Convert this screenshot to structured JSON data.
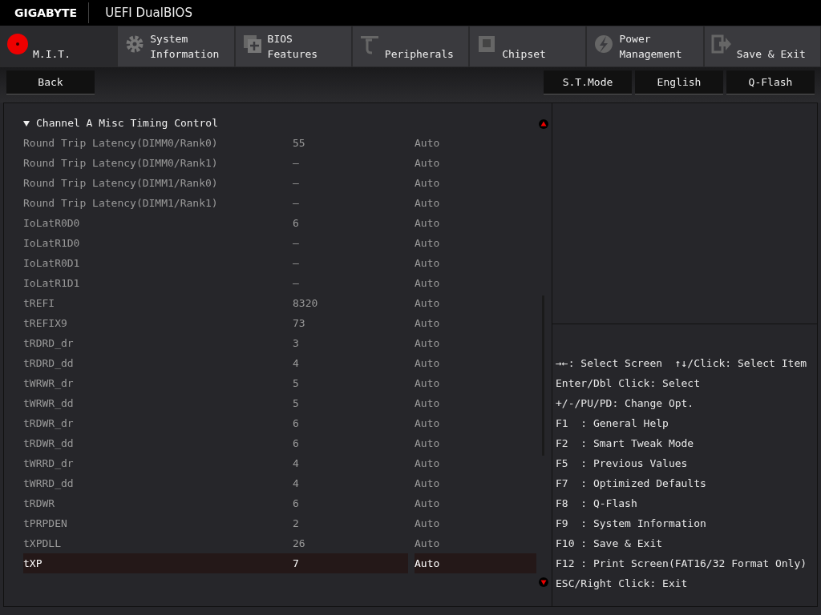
{
  "header": {
    "brand": "GIGABYTE",
    "title": "UEFI DualBIOS"
  },
  "tabs": [
    {
      "label": "M.I.T.",
      "selected": true
    },
    {
      "label": "System Information",
      "selected": false
    },
    {
      "label": "BIOS Features",
      "selected": false
    },
    {
      "label": "Peripherals",
      "selected": false
    },
    {
      "label": "Chipset",
      "selected": false
    },
    {
      "label": "Power Management",
      "selected": false
    },
    {
      "label": "Save & Exit",
      "selected": false
    }
  ],
  "toolbar": {
    "left_buttons": [
      "Back"
    ],
    "right_buttons": [
      "S.T.Mode",
      "English",
      "Q-Flash"
    ]
  },
  "section": {
    "title": "Channel A Misc Timing Control",
    "expanded": true
  },
  "rows": [
    {
      "name": "Round Trip Latency(DIMM0/Rank0)",
      "value": "55",
      "setting": "Auto",
      "selected": false
    },
    {
      "name": "Round Trip Latency(DIMM0/Rank1)",
      "value": "–",
      "setting": "Auto",
      "selected": false
    },
    {
      "name": "Round Trip Latency(DIMM1/Rank0)",
      "value": "–",
      "setting": "Auto",
      "selected": false
    },
    {
      "name": "Round Trip Latency(DIMM1/Rank1)",
      "value": "–",
      "setting": "Auto",
      "selected": false
    },
    {
      "name": "IoLatR0D0",
      "value": "6",
      "setting": "Auto",
      "selected": false
    },
    {
      "name": "IoLatR1D0",
      "value": "–",
      "setting": "Auto",
      "selected": false
    },
    {
      "name": "IoLatR0D1",
      "value": "–",
      "setting": "Auto",
      "selected": false
    },
    {
      "name": "IoLatR1D1",
      "value": "–",
      "setting": "Auto",
      "selected": false
    },
    {
      "name": "tREFI",
      "value": "8320",
      "setting": "Auto",
      "selected": false
    },
    {
      "name": "tREFIX9",
      "value": "73",
      "setting": "Auto",
      "selected": false
    },
    {
      "name": "tRDRD_dr",
      "value": "3",
      "setting": "Auto",
      "selected": false
    },
    {
      "name": "tRDRD_dd",
      "value": "4",
      "setting": "Auto",
      "selected": false
    },
    {
      "name": "tWRWR_dr",
      "value": "5",
      "setting": "Auto",
      "selected": false
    },
    {
      "name": "tWRWR_dd",
      "value": "5",
      "setting": "Auto",
      "selected": false
    },
    {
      "name": "tRDWR_dr",
      "value": "6",
      "setting": "Auto",
      "selected": false
    },
    {
      "name": "tRDWR_dd",
      "value": "6",
      "setting": "Auto",
      "selected": false
    },
    {
      "name": "tWRRD_dr",
      "value": "4",
      "setting": "Auto",
      "selected": false
    },
    {
      "name": "tWRRD_dd",
      "value": "4",
      "setting": "Auto",
      "selected": false
    },
    {
      "name": "tRDWR",
      "value": "6",
      "setting": "Auto",
      "selected": false
    },
    {
      "name": "tPRPDEN",
      "value": "2",
      "setting": "Auto",
      "selected": false
    },
    {
      "name": "tXPDLL",
      "value": "26",
      "setting": "Auto",
      "selected": false
    },
    {
      "name": "tXP",
      "value": "7",
      "setting": "Auto",
      "selected": true
    }
  ],
  "help": [
    "→←: Select Screen  ↑↓/Click: Select Item",
    "Enter/Dbl Click: Select",
    "+/-/PU/PD: Change Opt.",
    "F1  : General Help",
    "F2  : Smart Tweak Mode",
    "F5  : Previous Values",
    "F7  : Optimized Defaults",
    "F8  : Q-Flash",
    "F9  : System Information",
    "F10 : Save & Exit",
    "F12 : Print Screen(FAT16/32 Format Only)",
    "ESC/Right Click: Exit"
  ]
}
